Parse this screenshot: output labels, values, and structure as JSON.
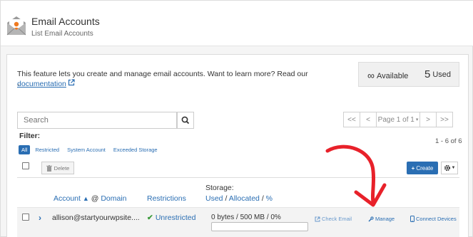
{
  "header": {
    "title": "Email Accounts",
    "subtitle": "List Email Accounts"
  },
  "intro": {
    "text": "This feature lets you create and manage email accounts. Want to learn more? Read our ",
    "link": "documentation",
    "trailing": "-"
  },
  "stats": {
    "available_value": "∞",
    "available_label": "Available",
    "used_value": "5",
    "used_label": "Used"
  },
  "search": {
    "placeholder": "Search"
  },
  "pagination": {
    "first": "<<",
    "prev": "<",
    "page": "Page 1 of 1",
    "next": ">",
    "last": ">>",
    "count": "1 - 6 of 6"
  },
  "filters": {
    "label": "Filter:",
    "items": [
      "All",
      "Restricted",
      "System Account",
      "Exceeded Storage"
    ]
  },
  "actions": {
    "delete": "Delete",
    "create": "Create"
  },
  "table": {
    "col_account": "Account",
    "col_domain_sep": "@",
    "col_domain": "Domain",
    "col_restrictions": "Restrictions",
    "col_storage": "Storage:",
    "col_used": "Used",
    "col_slash1": "/",
    "col_allocated": "Allocated",
    "col_slash2": "/",
    "col_percent": "%",
    "rows": [
      {
        "email": "allison@startyourwpsite....",
        "restriction": "Unrestricted",
        "storage": "0 bytes / 500 MB / 0%",
        "usage_fraction": 0,
        "check_email": "Check Email",
        "manage": "Manage",
        "connect": "Connect Devices"
      }
    ]
  },
  "colors": {
    "accent": "#2a6eb3",
    "success": "#3a9a3a",
    "annotation_arrow": "#e8212a"
  }
}
